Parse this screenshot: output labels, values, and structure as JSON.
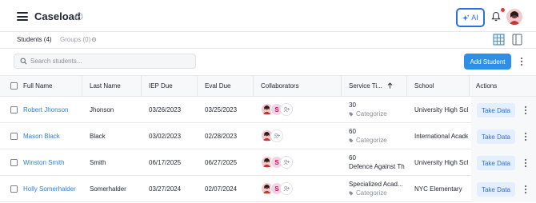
{
  "header": {
    "title": "Caseload",
    "ai_label": "AI",
    "colors": {
      "primary": "#2f6fe4",
      "notification": "#e53935"
    },
    "icons": [
      "menu-icon",
      "title-badge-icon",
      "sparkle-icon",
      "bell-icon",
      "avatar"
    ]
  },
  "tabs": {
    "students": "Students (4)",
    "groups": "Groups (0)"
  },
  "toolbar": {
    "search_placeholder": "Search students...",
    "add_student": "Add Student"
  },
  "table": {
    "headers": {
      "full_name": "Full Name",
      "last_name": "Last Name",
      "iep_due": "IEP Due",
      "eval_due": "Eval Due",
      "collaborators": "Collaborators",
      "service_time": "Service Ti...",
      "school": "School",
      "actions": "Actions"
    },
    "action_label": "Take Data",
    "collaborator_initial": "S",
    "rows": [
      {
        "full_name": "Robert Jhonson",
        "last_name": "Jhonson",
        "iep_due": "03/26/2023",
        "eval_due": "03/25/2023",
        "service_time": "30",
        "service_sub": "Categorize",
        "school": "University High School"
      },
      {
        "full_name": "Mason Black",
        "last_name": "Black",
        "iep_due": "03/02/2023",
        "eval_due": "02/28/2023",
        "service_time": "60",
        "service_sub": "Categorize",
        "school": "International Academy"
      },
      {
        "full_name": "Winston Smith",
        "last_name": "Smith",
        "iep_due": "06/17/2025",
        "eval_due": "06/27/2025",
        "service_time": "60",
        "service_sub": "Defence Against The",
        "school": "University High School"
      },
      {
        "full_name": "Holly Somerhalder",
        "last_name": "Somerhalder",
        "iep_due": "03/27/2024",
        "eval_due": "02/07/2024",
        "service_time": "Specialized Acad...",
        "service_sub": "Categorize",
        "school": "NYC Elementary"
      }
    ]
  }
}
